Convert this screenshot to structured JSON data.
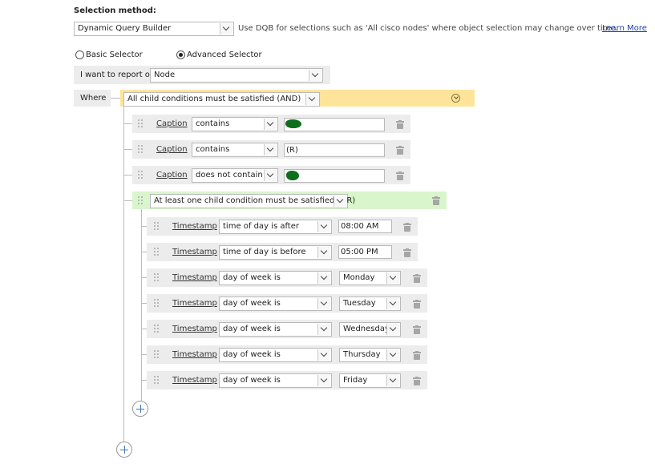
{
  "selection": {
    "label": "Selection method:",
    "method_value": "Dynamic Query Builder",
    "hint": "Use DQB for selections such as 'All cisco nodes' where object selection may change over time.",
    "learn_more": "Learn More"
  },
  "selector": {
    "basic_label": "Basic Selector",
    "advanced_label": "Advanced Selector",
    "selected": "Advanced Selector"
  },
  "report": {
    "label": "I want to report on",
    "value": "Node"
  },
  "where": {
    "label": "Where",
    "group_value": "All child conditions must be satisfied (AND)",
    "accent": "#fde49a"
  },
  "conditions": [
    {
      "field": "Caption",
      "operator": "contains",
      "value": ""
    },
    {
      "field": "Caption",
      "operator": "contains",
      "value": "(R)"
    },
    {
      "field": "Caption",
      "operator": "does not contain",
      "value": ""
    }
  ],
  "or_group": {
    "value": "At least one child condition must be satisfied (OR)",
    "accent": "#d9f5cc",
    "conditions": [
      {
        "field": "Timestamp",
        "operator": "time of day is after",
        "value": "08:00 AM",
        "kind": "input"
      },
      {
        "field": "Timestamp",
        "operator": "time of day is before",
        "value": "05:00 PM",
        "kind": "input"
      },
      {
        "field": "Timestamp",
        "operator": "day of week is",
        "value": "Monday",
        "kind": "select"
      },
      {
        "field": "Timestamp",
        "operator": "day of week is",
        "value": "Tuesday",
        "kind": "select"
      },
      {
        "field": "Timestamp",
        "operator": "day of week is",
        "value": "Wednesday",
        "kind": "select"
      },
      {
        "field": "Timestamp",
        "operator": "day of week is",
        "value": "Thursday",
        "kind": "select"
      },
      {
        "field": "Timestamp",
        "operator": "day of week is",
        "value": "Friday",
        "kind": "select"
      }
    ]
  },
  "icons": {
    "drag": "drag-handle-icon",
    "delete": "trash-icon",
    "add": "add-circle-icon",
    "collapse": "chevron-down-circle-icon"
  },
  "colors": {
    "link": "#1a3fa8",
    "row_bg": "#ececec"
  }
}
